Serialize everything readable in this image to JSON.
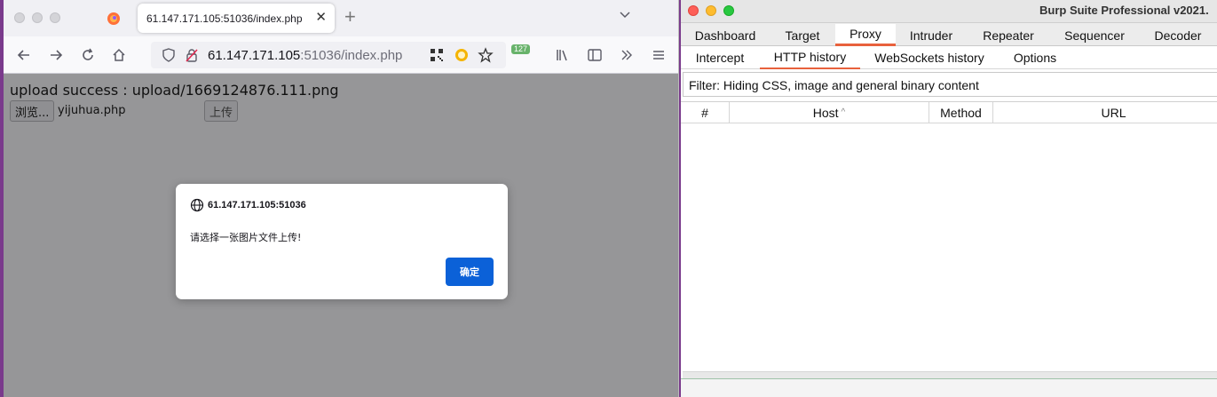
{
  "firefox": {
    "tab": {
      "title": "61.147.171.105:51036/index.php",
      "close": "✕"
    },
    "new_tab": "+",
    "url": {
      "host": "61.147.171.105",
      "rest": ":51036/index.php"
    },
    "badge": "127",
    "page": {
      "upload_message": "upload success : upload/1669124876.111.png",
      "browse_label": "浏览...",
      "file_name": "yijuhua.php",
      "upload_label": "上传"
    },
    "dialog": {
      "origin": "61.147.171.105:51036",
      "message": "请选择一张图片文件上传!",
      "ok_label": "确定"
    }
  },
  "burp": {
    "title": "Burp Suite Professional v2021.",
    "tabs": [
      "Dashboard",
      "Target",
      "Proxy",
      "Intruder",
      "Repeater",
      "Sequencer",
      "Decoder"
    ],
    "active_tab": "Proxy",
    "subtabs": [
      "Intercept",
      "HTTP history",
      "WebSockets history",
      "Options"
    ],
    "active_subtab": "HTTP history",
    "filter": "Filter: Hiding CSS, image and general binary content",
    "columns": [
      "#",
      "Host",
      "Method",
      "URL"
    ],
    "sort_indicator": "^"
  }
}
